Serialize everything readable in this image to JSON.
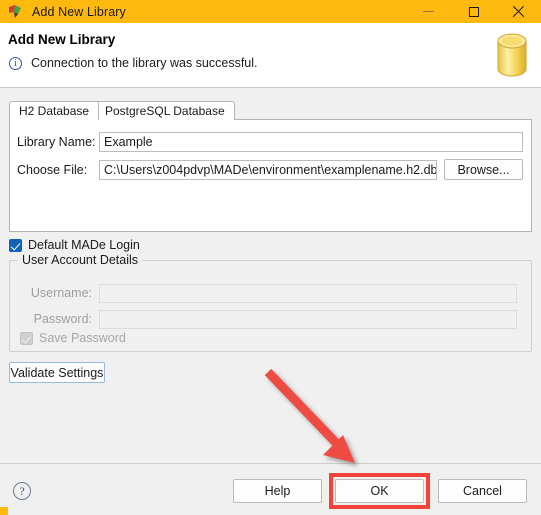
{
  "window": {
    "title": "Add New Library",
    "app_icon": "made-leaf-icon",
    "titlebar_color": "#ffb90f",
    "controls": {
      "minimize": "minimize-icon",
      "maximize": "maximize-icon",
      "close": "close-icon"
    }
  },
  "header": {
    "title": "Add New Library",
    "status_icon": "info-icon",
    "status_glyph": "ⓘ",
    "status_message": "Connection to the library was successful.",
    "decoration_icon": "database-cylinder-icon"
  },
  "tabs": [
    {
      "label": "H2 Database",
      "selected": true
    },
    {
      "label": "PostgreSQL Database",
      "selected": false
    }
  ],
  "form": {
    "library_name_label": "Library Name:",
    "library_name_value": "Example",
    "library_name_placeholder": "",
    "choose_file_label": "Choose File:",
    "choose_file_value": "C:\\Users\\z004pdvp\\MADe\\environment\\examplename.h2.db",
    "choose_file_placeholder": "",
    "browse_label": "Browse..."
  },
  "default_login": {
    "label": "Default MADe Login",
    "checked": true
  },
  "user_account": {
    "group_label": "User Account Details",
    "username_label": "Username:",
    "username_value": "",
    "password_label": "Password:",
    "password_value": "",
    "save_password_label": "Save Password",
    "save_password_checked": true,
    "enabled": false
  },
  "validate": {
    "label": "Validate Settings"
  },
  "footer": {
    "help_icon": "help-circle-icon",
    "help_glyph": "?",
    "buttons": {
      "help": "Help",
      "ok": "OK",
      "cancel": "Cancel"
    }
  },
  "annotations": {
    "highlight_color": "#f4433b",
    "highlight_target": "OK",
    "arrow_color": "#ee4b42",
    "arrow_direction": "down-right"
  }
}
